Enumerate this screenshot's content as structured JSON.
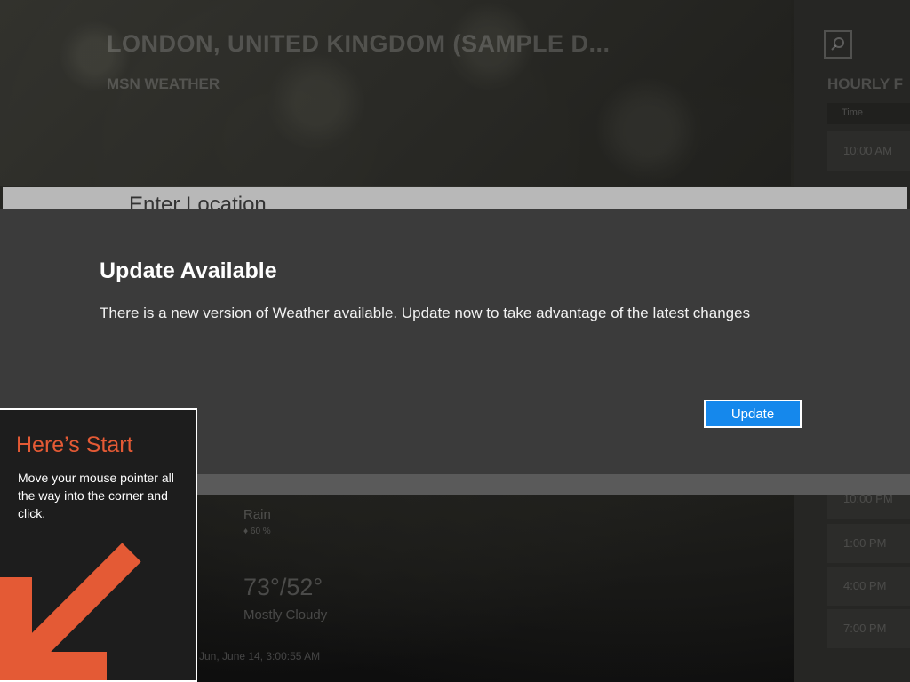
{
  "app": {
    "city_title": "LONDON, UNITED KINGDOM (SAMPLE D...",
    "app_name": "MSN WEATHER",
    "search_icon": "search-icon",
    "enter_location_placeholder": "Enter Location",
    "hourly": {
      "title": "HOURLY F",
      "column_header": "Time",
      "times": [
        "10:00 AM",
        "10:00 PM",
        "1:00 PM",
        "4:00 PM",
        "7:00 PM"
      ]
    },
    "daily": {
      "condition_1": "Rain",
      "precip_1": "♦ 60 %",
      "temps_2": "73°/52°",
      "condition_2": "Mostly Cloudy",
      "updated": "Jun, June 14, 3:00:55 AM"
    }
  },
  "dialog": {
    "title": "Update Available",
    "message": "There is a new version of Weather available. Update now to take advantage of the latest changes",
    "update_button": "Update",
    "accent_color": "#1588ec"
  },
  "tip": {
    "title": "Here’s Start",
    "body": "Move your mouse pointer all the way into the corner and click.",
    "arrow_icon": "arrow-down-left-icon",
    "accent_color": "#e45a35"
  }
}
